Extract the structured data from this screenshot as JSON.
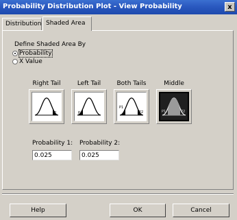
{
  "window": {
    "title": "Probability Distribution Plot - View Probability",
    "close_glyph": "x"
  },
  "tabs": [
    {
      "label": "Distribution",
      "active": false
    },
    {
      "label": "Shaded Area",
      "active": true
    }
  ],
  "define": {
    "heading": "Define Shaded Area By",
    "options": [
      {
        "label": "Probability",
        "selected": true
      },
      {
        "label": "X Value",
        "selected": false
      }
    ]
  },
  "area_options": [
    {
      "label": "Right Tail",
      "selected": false
    },
    {
      "label": "Left Tail",
      "selected": false
    },
    {
      "label": "Both Tails",
      "selected": false
    },
    {
      "label": "Middle",
      "selected": true
    }
  ],
  "fields": [
    {
      "label": "Probability 1:",
      "value": "0.025"
    },
    {
      "label": "Probability 2:",
      "value": "0.025"
    }
  ],
  "buttons": {
    "help": "Help",
    "ok": "OK",
    "cancel": "Cancel"
  }
}
